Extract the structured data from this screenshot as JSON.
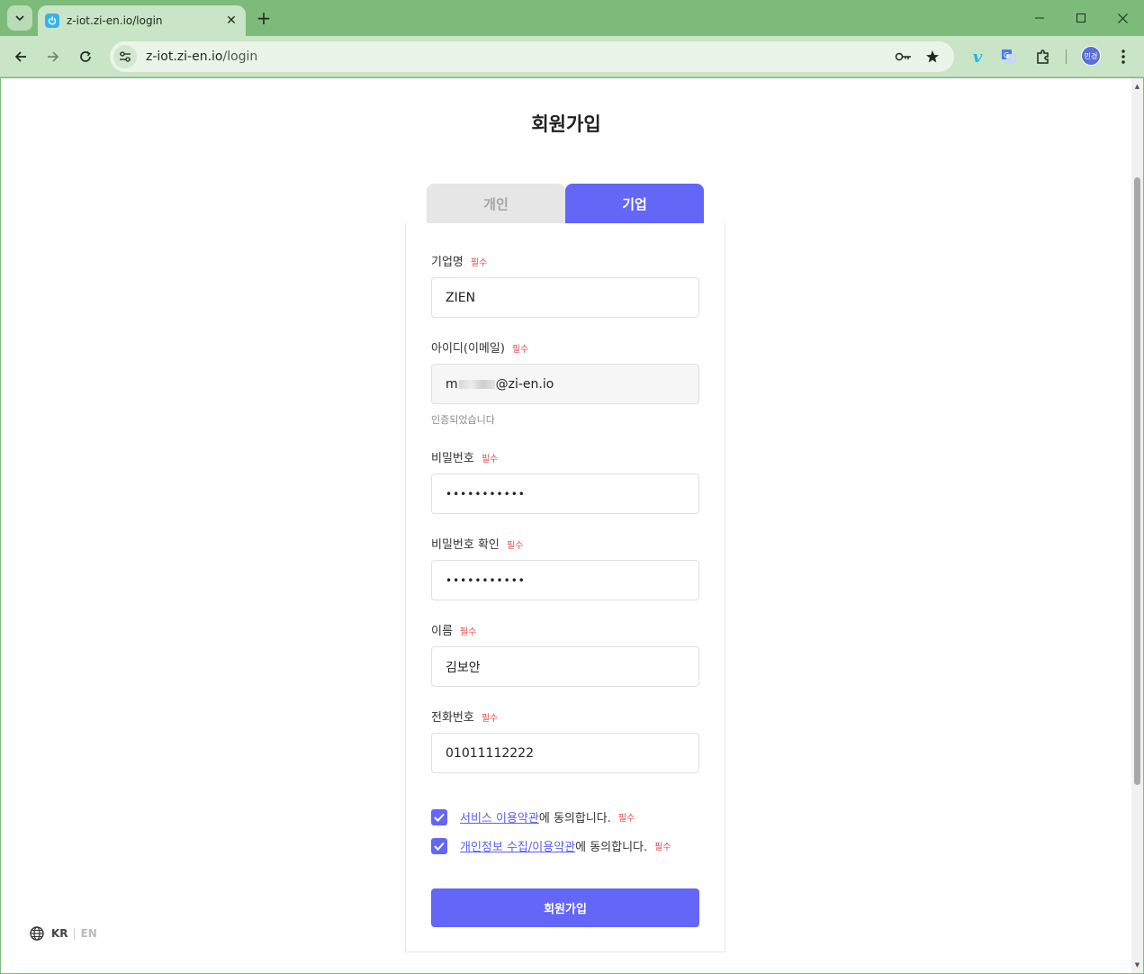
{
  "browser": {
    "tab_title": "z-iot.zi-en.io/login",
    "url_host": "z-iot.zi-en.io",
    "url_path": "/login",
    "profile_initials": "민경"
  },
  "page": {
    "title": "회원가입",
    "tabs": [
      "개인",
      "기업"
    ],
    "active_tab": "기업",
    "required_badge": "필수",
    "fields": {
      "company": {
        "label": "기업명",
        "value": "ZIEN"
      },
      "email": {
        "label": "아이디(이메일)",
        "value_prefix": "m",
        "value_suffix": "@zi-en.io",
        "hint": "인증되었습니다"
      },
      "password": {
        "label": "비밀번호",
        "value": "•••••••••••"
      },
      "password_confirm": {
        "label": "비밀번호 확인",
        "value": "•••••••••••"
      },
      "name": {
        "label": "이름",
        "value": "김보안"
      },
      "phone": {
        "label": "전화번호",
        "value": "01011112222"
      }
    },
    "agreements": [
      {
        "link": "서비스 이용약관",
        "text": "에 동의합니다.",
        "checked": true
      },
      {
        "link": "개인정보 수집/이용약관",
        "text": "에 동의합니다.",
        "checked": true
      }
    ],
    "submit_label": "회원가입",
    "language": {
      "kr": "KR",
      "separator": "|",
      "en": "EN"
    }
  },
  "colors": {
    "accent": "#6366f6",
    "required": "#e84a4a",
    "chrome": "#7dbb7b"
  }
}
